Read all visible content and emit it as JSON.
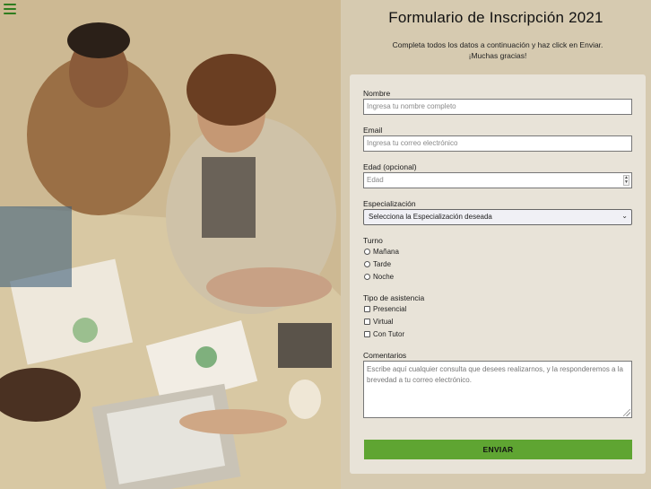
{
  "header": {
    "title": "Formulario de Inscripción 2021",
    "subtitle_line1": "Completa todos los datos a continuación y haz click en Enviar.",
    "subtitle_line2": "¡Muchas gracias!"
  },
  "menu": {
    "icon": "hamburger-menu-icon"
  },
  "form": {
    "nombre": {
      "label": "Nombre",
      "placeholder": "Ingresa tu nombre completo"
    },
    "email": {
      "label": "Email",
      "placeholder": "Ingresa tu correo electrónico"
    },
    "edad": {
      "label": "Edad (opcional)",
      "placeholder": "Edad"
    },
    "especializacion": {
      "label": "Especialización",
      "selected": "Selecciona la Especialización deseada"
    },
    "turno": {
      "label": "Turno",
      "options": [
        "Mañana",
        "Tarde",
        "Noche"
      ]
    },
    "asistencia": {
      "label": "Tipo de asistencia",
      "options": [
        "Presencial",
        "Virtual",
        "Con Tutor"
      ]
    },
    "comentarios": {
      "label": "Comentarios",
      "placeholder": "Escribe aquí cualquier consulta que desees realizarnos, y la responderemos a la brevedad a tu correo electrónico."
    },
    "submit_label": "ENVIAR"
  },
  "colors": {
    "accent": "#5fa532",
    "panel": "#d6cab0",
    "card": "#e8e3d8"
  }
}
